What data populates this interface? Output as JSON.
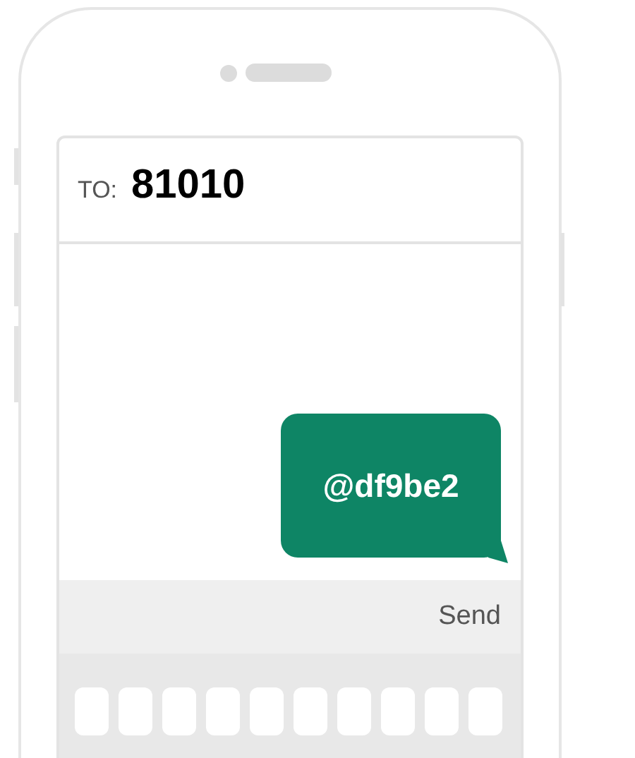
{
  "recipient": {
    "label": "TO:",
    "number": "81010"
  },
  "messages": [
    {
      "text": "@df9be2"
    }
  ],
  "send_button": {
    "label": "Send"
  }
}
